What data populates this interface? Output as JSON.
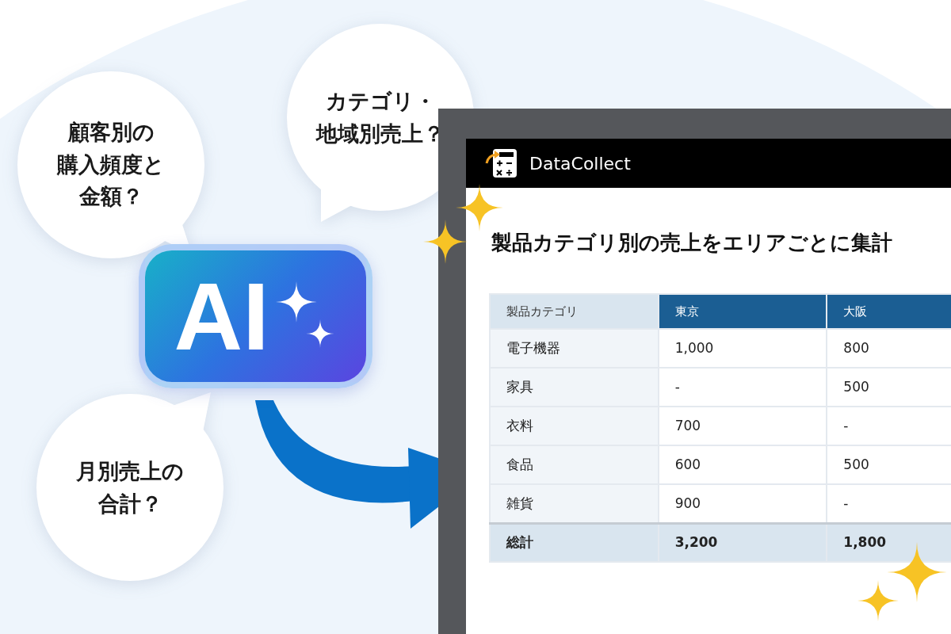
{
  "bubbles": [
    {
      "lines": [
        "顧客別の",
        "購入頻度と",
        "金額？"
      ]
    },
    {
      "lines": [
        "カテゴリ・",
        "地域別売上？"
      ]
    },
    {
      "lines": [
        "月別売上の",
        "合計？"
      ]
    }
  ],
  "badge": {
    "text": "AI"
  },
  "app": {
    "name": "DataCollect",
    "title": "製品カテゴリ別の売上をエリアごとに集計",
    "table": {
      "columns": [
        "製品カテゴリ",
        "東京",
        "大阪"
      ],
      "rows": [
        [
          "電子機器",
          "1,000",
          "800"
        ],
        [
          "家具",
          "-",
          "500"
        ],
        [
          "衣料",
          "700",
          "-"
        ],
        [
          "食品",
          "600",
          "500"
        ],
        [
          "雑貨",
          "900",
          "-"
        ]
      ],
      "total": [
        "総計",
        "3,200",
        "1,800"
      ]
    }
  }
}
